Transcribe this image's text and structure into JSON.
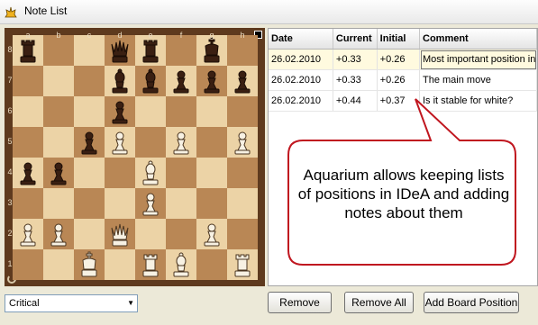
{
  "window": {
    "title": "Note List",
    "icon": "chess-piece-icon"
  },
  "board": {
    "files": [
      "a",
      "b",
      "c",
      "d",
      "e",
      "f",
      "g",
      "h"
    ],
    "ranks": [
      "8",
      "7",
      "6",
      "5",
      "4",
      "3",
      "2",
      "1"
    ],
    "position": [
      [
        "bR",
        "",
        "",
        "bQ",
        "bR",
        "",
        "bK",
        ""
      ],
      [
        "",
        "",
        "",
        "bB",
        "bB",
        "bP",
        "bP",
        "bP"
      ],
      [
        "",
        "",
        "",
        "bP",
        "",
        "",
        "",
        ""
      ],
      [
        "",
        "",
        "bP",
        "wP",
        "",
        "wP",
        "",
        "wP"
      ],
      [
        "bP",
        "bP",
        "",
        "",
        "wB",
        "",
        "",
        ""
      ],
      [
        "",
        "",
        "",
        "",
        "wP",
        "",
        "",
        ""
      ],
      [
        "wP",
        "wP",
        "",
        "wQ",
        "",
        "",
        "wP",
        ""
      ],
      [
        "",
        "",
        "wK",
        "",
        "wR",
        "wB",
        "",
        "wR"
      ]
    ],
    "colors": {
      "light": "#ecd3a6",
      "dark": "#b98755",
      "frame": "#5e3a1e"
    }
  },
  "notes": {
    "columns": [
      "Date",
      "Current",
      "Initial",
      "Comment"
    ],
    "rows": [
      {
        "date": "26.02.2010",
        "current": "+0.33",
        "initial": "+0.26",
        "comment": "Most important position in"
      },
      {
        "date": "26.02.2010",
        "current": "+0.33",
        "initial": "+0.26",
        "comment": "The main move"
      },
      {
        "date": "26.02.2010",
        "current": "+0.44",
        "initial": "+0.37",
        "comment": "Is it stable for white?"
      }
    ],
    "selected_row": 0
  },
  "callout": {
    "text": "Aquarium allows keeping lists of positions in IDeA and adding notes about them",
    "color": "#c0161f"
  },
  "filter": {
    "value": "Critical"
  },
  "buttons": {
    "remove": "Remove",
    "remove_all": "Remove All",
    "add_board_position": "Add Board Position"
  }
}
